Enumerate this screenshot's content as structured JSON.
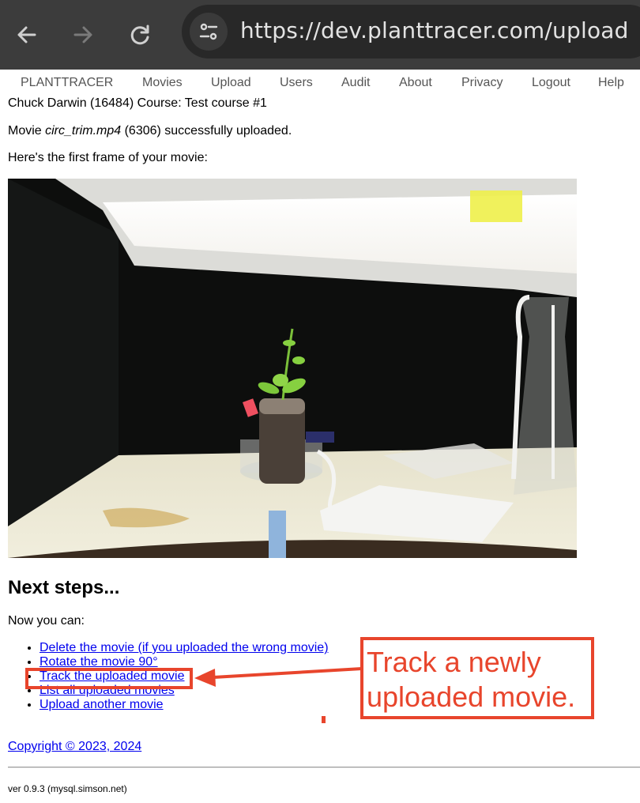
{
  "browser": {
    "url": "https://dev.planttracer.com/upload",
    "icons": {
      "back": "arrow-left-icon",
      "forward": "arrow-right-icon",
      "reload": "reload-icon",
      "site_info": "tune-icon"
    }
  },
  "nav": {
    "items": [
      {
        "label": "PLANTTRACER"
      },
      {
        "label": "Movies"
      },
      {
        "label": "Upload"
      },
      {
        "label": "Users"
      },
      {
        "label": "Audit"
      },
      {
        "label": "About"
      },
      {
        "label": "Privacy"
      },
      {
        "label": "Logout"
      },
      {
        "label": "Help"
      }
    ]
  },
  "user": {
    "line": "Chuck Darwin (16484) Course: Test course #1"
  },
  "upload": {
    "prefix": "Movie ",
    "filename": "circ_trim.mp4",
    "suffix": " (6306) successfully uploaded.",
    "first_frame_text": "Here's the first frame of your movie:",
    "frame_alt": "First frame of uploaded movie: a small plant in a peat pellet on a lab tray under a lamp"
  },
  "next_steps": {
    "heading": "Next steps...",
    "intro": "Now you can:",
    "links": [
      {
        "label": "Delete the movie (if you uploaded the wrong movie)"
      },
      {
        "label": "Rotate the movie 90°"
      },
      {
        "label": "Track the uploaded movie"
      },
      {
        "label": "List all uploaded movies"
      },
      {
        "label": "Upload another movie"
      }
    ]
  },
  "footer": {
    "copyright": "Copyright © 2023, 2024",
    "version": "ver 0.9.3 (mysql.simson.net)"
  },
  "annotation": {
    "callout_line1": "Track a newly",
    "callout_line2": "uploaded movie.",
    "color": "#e8452c"
  }
}
